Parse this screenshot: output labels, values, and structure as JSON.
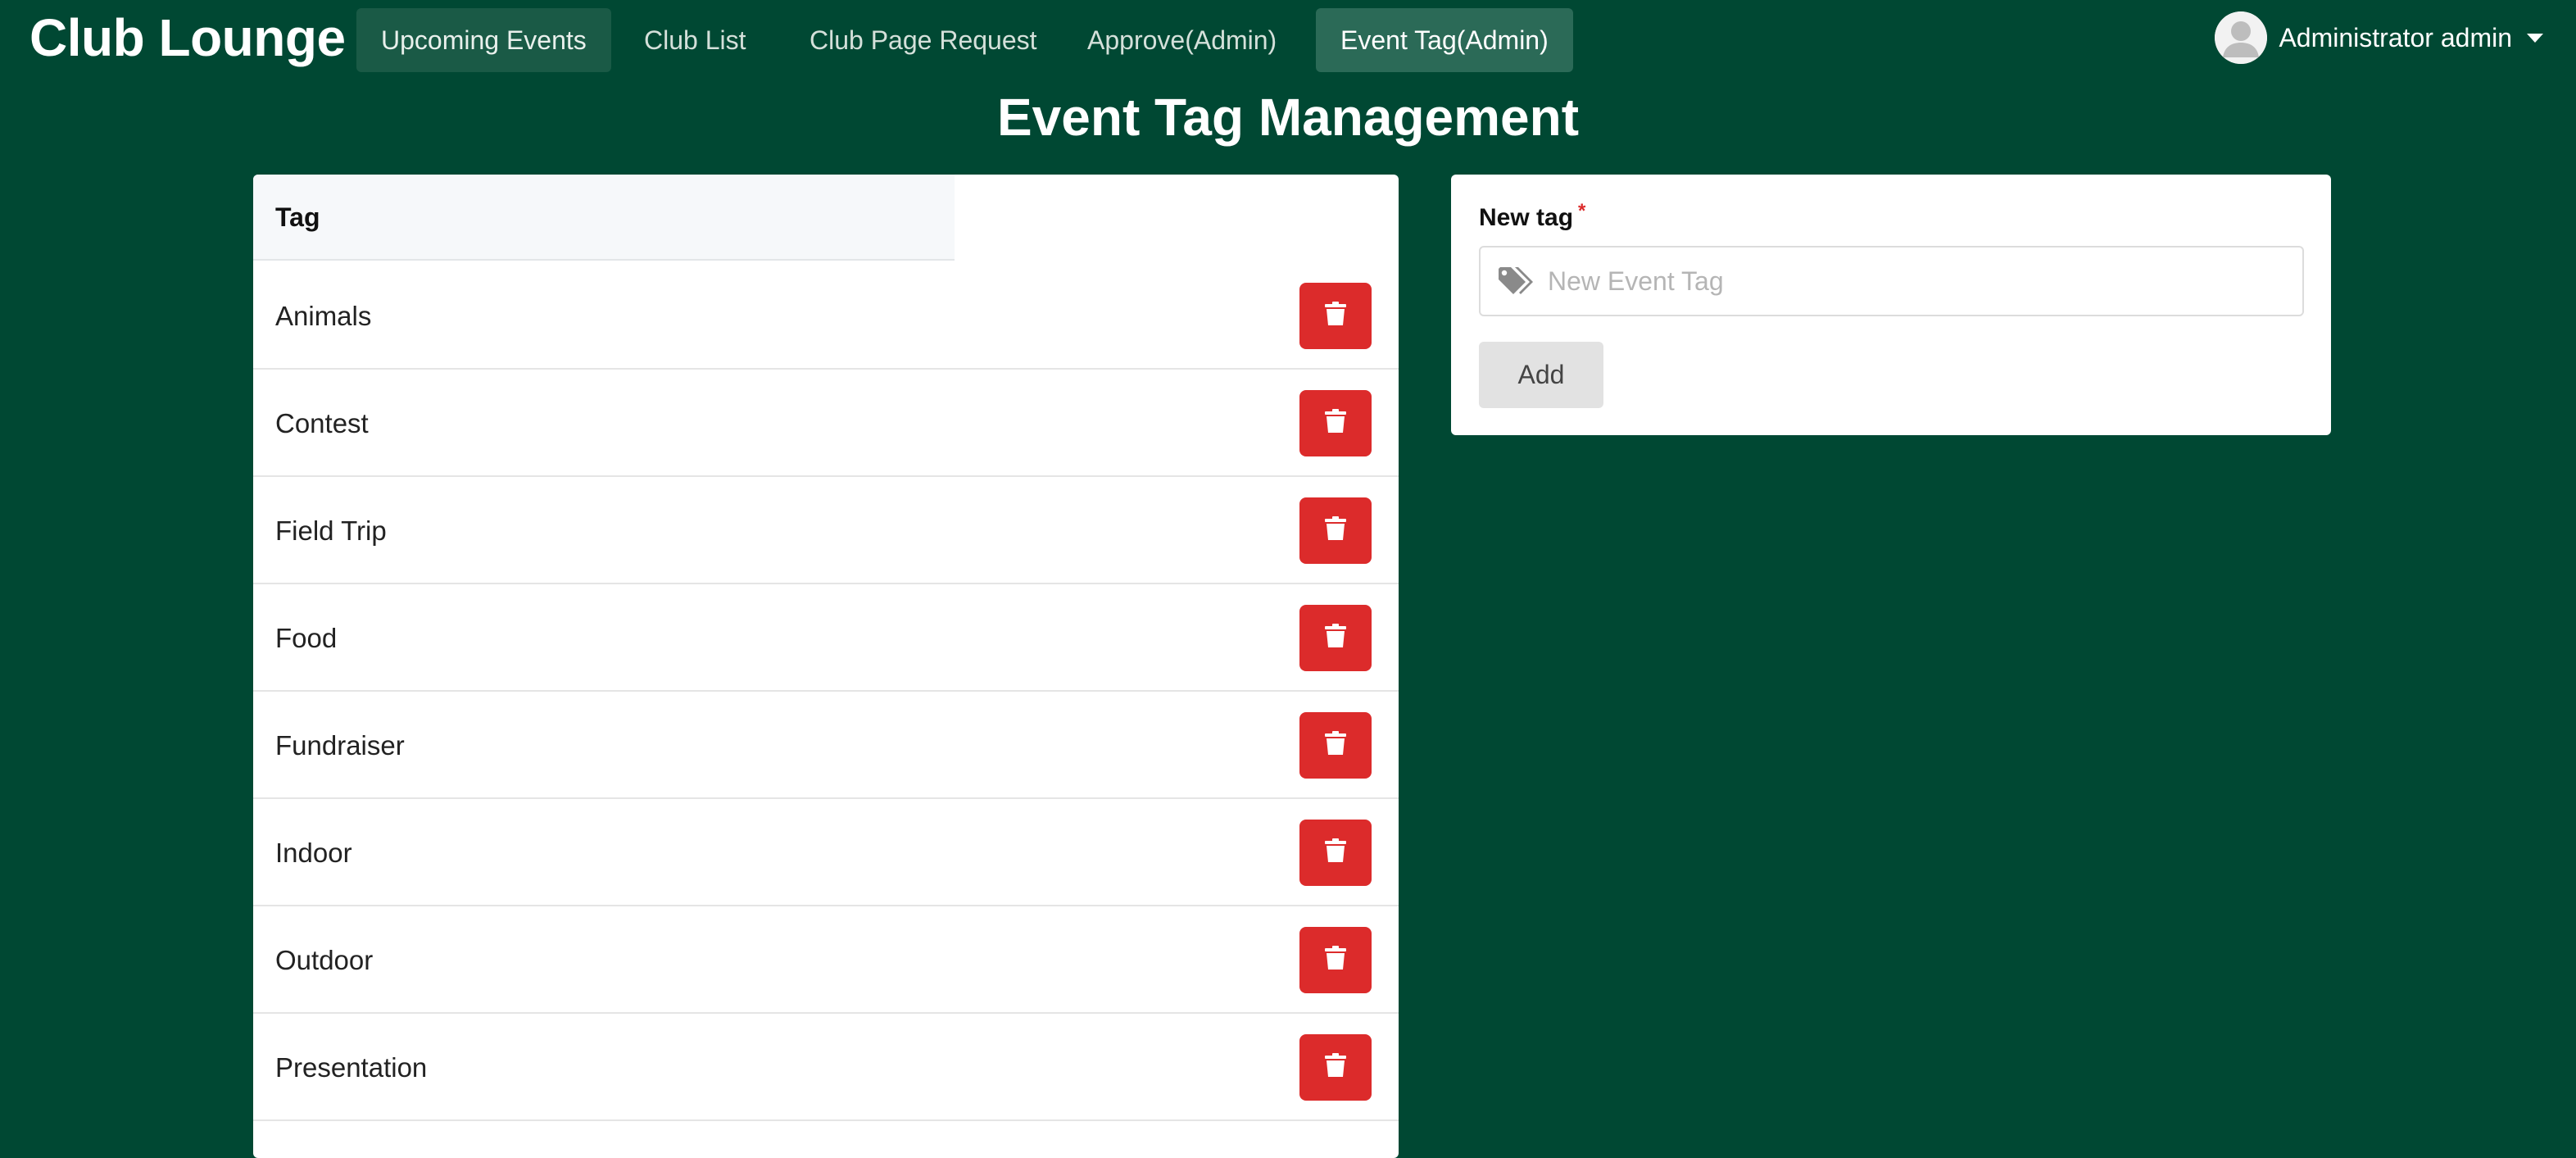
{
  "brand": "Club Lounge",
  "nav": [
    {
      "label": "Upcoming Events"
    },
    {
      "label": "Club List"
    },
    {
      "label": "Club Page Request"
    },
    {
      "label": "Approve(Admin)"
    },
    {
      "label": "Event Tag(Admin)"
    }
  ],
  "user": {
    "name": "Administrator admin",
    "avatar_icon": "user-avatar-icon",
    "menu_icon": "caret-down-icon"
  },
  "page_title": "Event Tag Management",
  "table": {
    "header": "Tag",
    "delete_icon": "trash-icon",
    "rows": [
      {
        "label": "Animals"
      },
      {
        "label": "Contest"
      },
      {
        "label": "Field Trip"
      },
      {
        "label": "Food"
      },
      {
        "label": "Fundraiser"
      },
      {
        "label": "Indoor"
      },
      {
        "label": "Outdoor"
      },
      {
        "label": "Presentation"
      }
    ]
  },
  "form": {
    "label": "New tag",
    "required_mark": "*",
    "input_icon": "tags-icon",
    "placeholder": "New Event Tag",
    "value": "",
    "submit_label": "Add"
  },
  "colors": {
    "background": "#004833",
    "active_nav": "#2b6a57",
    "delete": "#dc2b2b",
    "required": "#dc2b2b"
  }
}
